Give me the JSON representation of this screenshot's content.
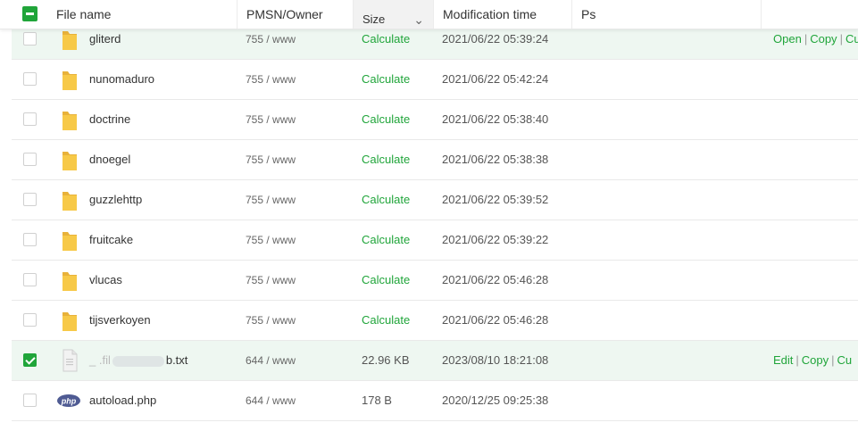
{
  "header": {
    "columns": {
      "file_name": "File name",
      "pmsn_owner": "PMSN/Owner",
      "size": "Size",
      "modification_time": "Modification time",
      "ps": "Ps"
    },
    "select_all_state": "indeterminate"
  },
  "rows": [
    {
      "name": "gliterd",
      "perm": "755 / www",
      "size": "Calculate",
      "mtime": "2021/06/22 05:39:24",
      "type": "folder",
      "checked": false,
      "ops": [
        "Open",
        "Copy",
        "Cu"
      ]
    },
    {
      "name": "nunomaduro",
      "perm": "755 / www",
      "size": "Calculate",
      "mtime": "2021/06/22 05:42:24",
      "type": "folder",
      "checked": false
    },
    {
      "name": "doctrine",
      "perm": "755 / www",
      "size": "Calculate",
      "mtime": "2021/06/22 05:38:40",
      "type": "folder",
      "checked": false
    },
    {
      "name": "dnoegel",
      "perm": "755 / www",
      "size": "Calculate",
      "mtime": "2021/06/22 05:38:38",
      "type": "folder",
      "checked": false
    },
    {
      "name": "guzzlehttp",
      "perm": "755 / www",
      "size": "Calculate",
      "mtime": "2021/06/22 05:39:52",
      "type": "folder",
      "checked": false
    },
    {
      "name": "fruitcake",
      "perm": "755 / www",
      "size": "Calculate",
      "mtime": "2021/06/22 05:39:22",
      "type": "folder",
      "checked": false
    },
    {
      "name": "vlucas",
      "perm": "755 / www",
      "size": "Calculate",
      "mtime": "2021/06/22 05:46:28",
      "type": "folder",
      "checked": false
    },
    {
      "name": "tijsverkoyen",
      "perm": "755 / www",
      "size": "Calculate",
      "mtime": "2021/06/22 05:46:28",
      "type": "folder",
      "checked": false
    },
    {
      "name_prefix": "_ .fil",
      "name_suffix": "b.txt",
      "perm": "644 / www",
      "size": "22.96 KB",
      "mtime": "2023/08/10 18:21:08",
      "type": "text-file",
      "checked": true,
      "ops": [
        "Edit",
        "Copy",
        "Cu"
      ]
    },
    {
      "name": "autoload.php",
      "perm": "644 / www",
      "size": "178 B",
      "mtime": "2020/12/25 09:25:38",
      "type": "php-file",
      "checked": false
    }
  ],
  "colors": {
    "accent": "#20a53a",
    "folder": "#f7c948",
    "highlight_row": "#eef7f1"
  }
}
